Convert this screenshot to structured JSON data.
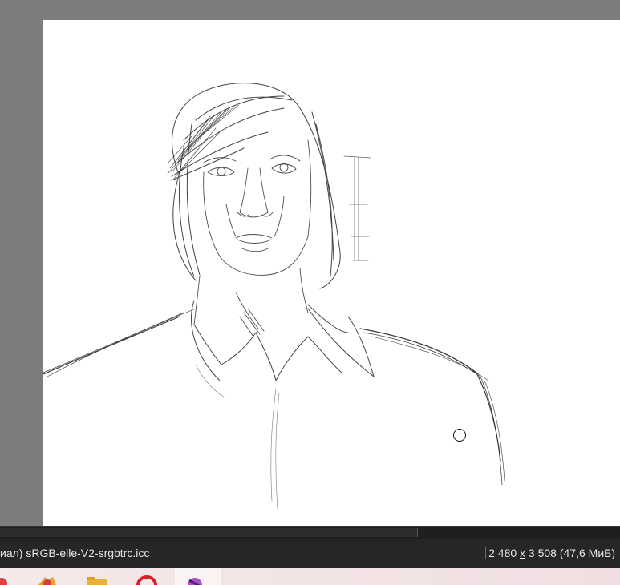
{
  "canvas": {
    "description_icon": "brush-cursor-icon"
  },
  "statusbar": {
    "color_profile": "иал)  sRGB-elle-V2-srgbtrc.icc",
    "image_size_prefix": "2 480 ",
    "image_size_x": "x",
    "image_size_suffix": " 3 508 (47,6 МиБ)"
  },
  "taskbar": {
    "apps": [
      "app-icon",
      "browser-icon",
      "folder-icon",
      "opera-icon",
      "krita-icon"
    ]
  },
  "colors": {
    "workspace": "#7d7d7d",
    "canvas": "#ffffff",
    "statusbar": "#262626",
    "taskbar": "#f3e4e6"
  }
}
